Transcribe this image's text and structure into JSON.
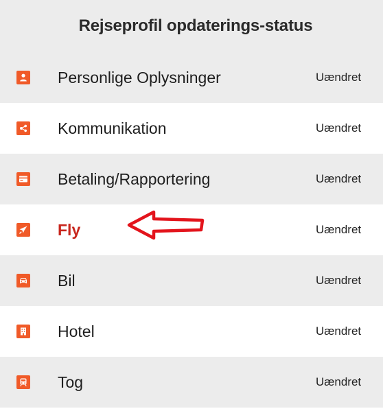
{
  "header": {
    "title": "Rejseprofil opdaterings-status"
  },
  "colors": {
    "icon_accent": "#f05a28",
    "active_label": "#c8261d",
    "annotation_arrow": "#e3141c",
    "row_shade": "#ececec"
  },
  "rows": [
    {
      "label": "Personlige Oplysninger",
      "status": "Uændret",
      "icon": "person-icon",
      "active": false
    },
    {
      "label": "Kommunikation",
      "status": "Uændret",
      "icon": "share-icon",
      "active": false
    },
    {
      "label": "Betaling/Rapportering",
      "status": "Uændret",
      "icon": "credit-card-icon",
      "active": false
    },
    {
      "label": "Fly",
      "status": "Uændret",
      "icon": "airplane-icon",
      "active": true
    },
    {
      "label": "Bil",
      "status": "Uændret",
      "icon": "car-icon",
      "active": false
    },
    {
      "label": "Hotel",
      "status": "Uændret",
      "icon": "hotel-icon",
      "active": false
    },
    {
      "label": "Tog",
      "status": "Uændret",
      "icon": "train-icon",
      "active": false
    }
  ],
  "annotation": {
    "icon": "left-arrow-outline-icon"
  }
}
